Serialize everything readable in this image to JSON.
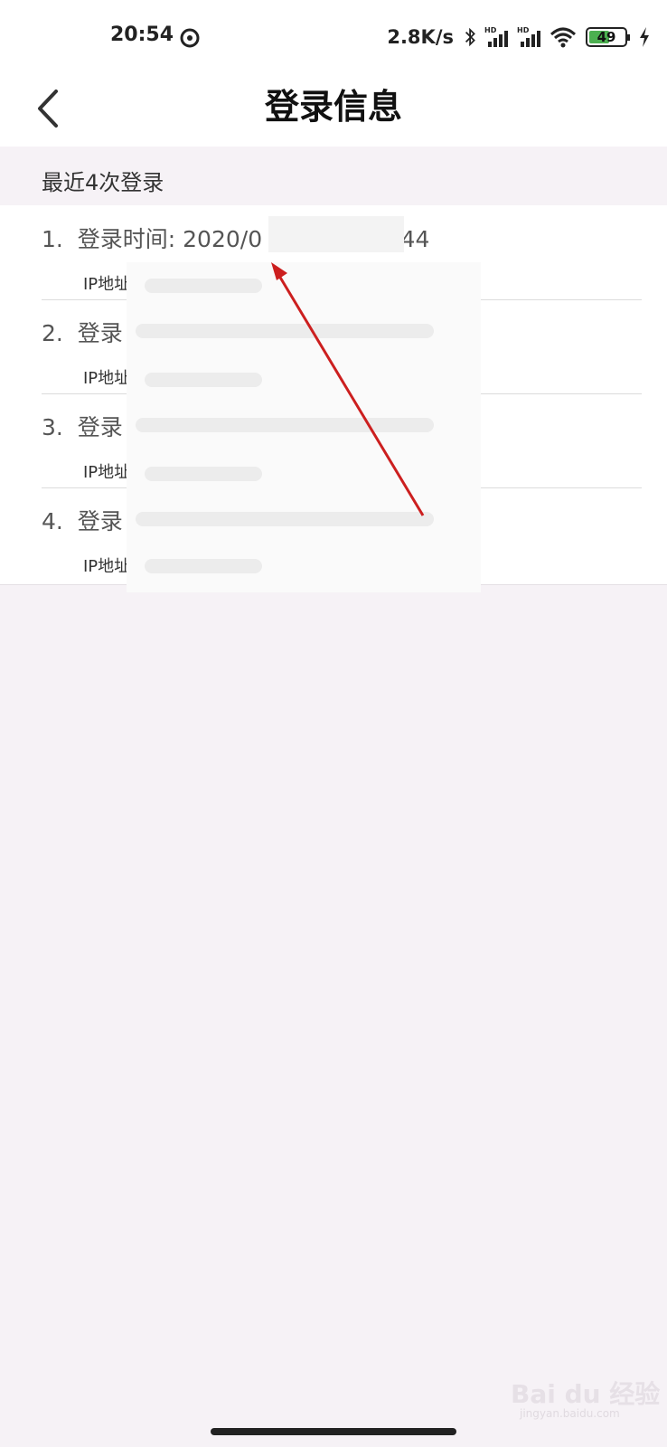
{
  "status_bar": {
    "time": "20:54",
    "net_speed": "2.8K/s",
    "battery": "49",
    "icons": [
      "dnd-icon",
      "bluetooth-icon",
      "signal-hd-icon",
      "signal-hd-icon",
      "wifi-icon",
      "battery-icon",
      "charging-icon"
    ]
  },
  "header": {
    "title": "登录信息",
    "back_icon": "chevron-left-icon"
  },
  "section": {
    "title": "最近4次登录"
  },
  "logins": [
    {
      "index": "1.",
      "time_label": "登录时间:",
      "time_visible_start": "2020/0",
      "time_visible_end": ":44",
      "ip_label": "IP地址"
    },
    {
      "index": "2.",
      "time_label": "登录",
      "ip_label": "IP地址"
    },
    {
      "index": "3.",
      "time_label": "登录",
      "ip_label": "IP地址"
    },
    {
      "index": "4.",
      "time_label": "登录",
      "ip_label": "IP地址"
    }
  ],
  "watermark": {
    "text": "Bai du 经验",
    "sub": "jingyan.baidu.com"
  },
  "colors": {
    "accent_arrow": "#cc1f1f",
    "section_bg": "#f6f2f6",
    "battery_fill": "#4caf50"
  }
}
